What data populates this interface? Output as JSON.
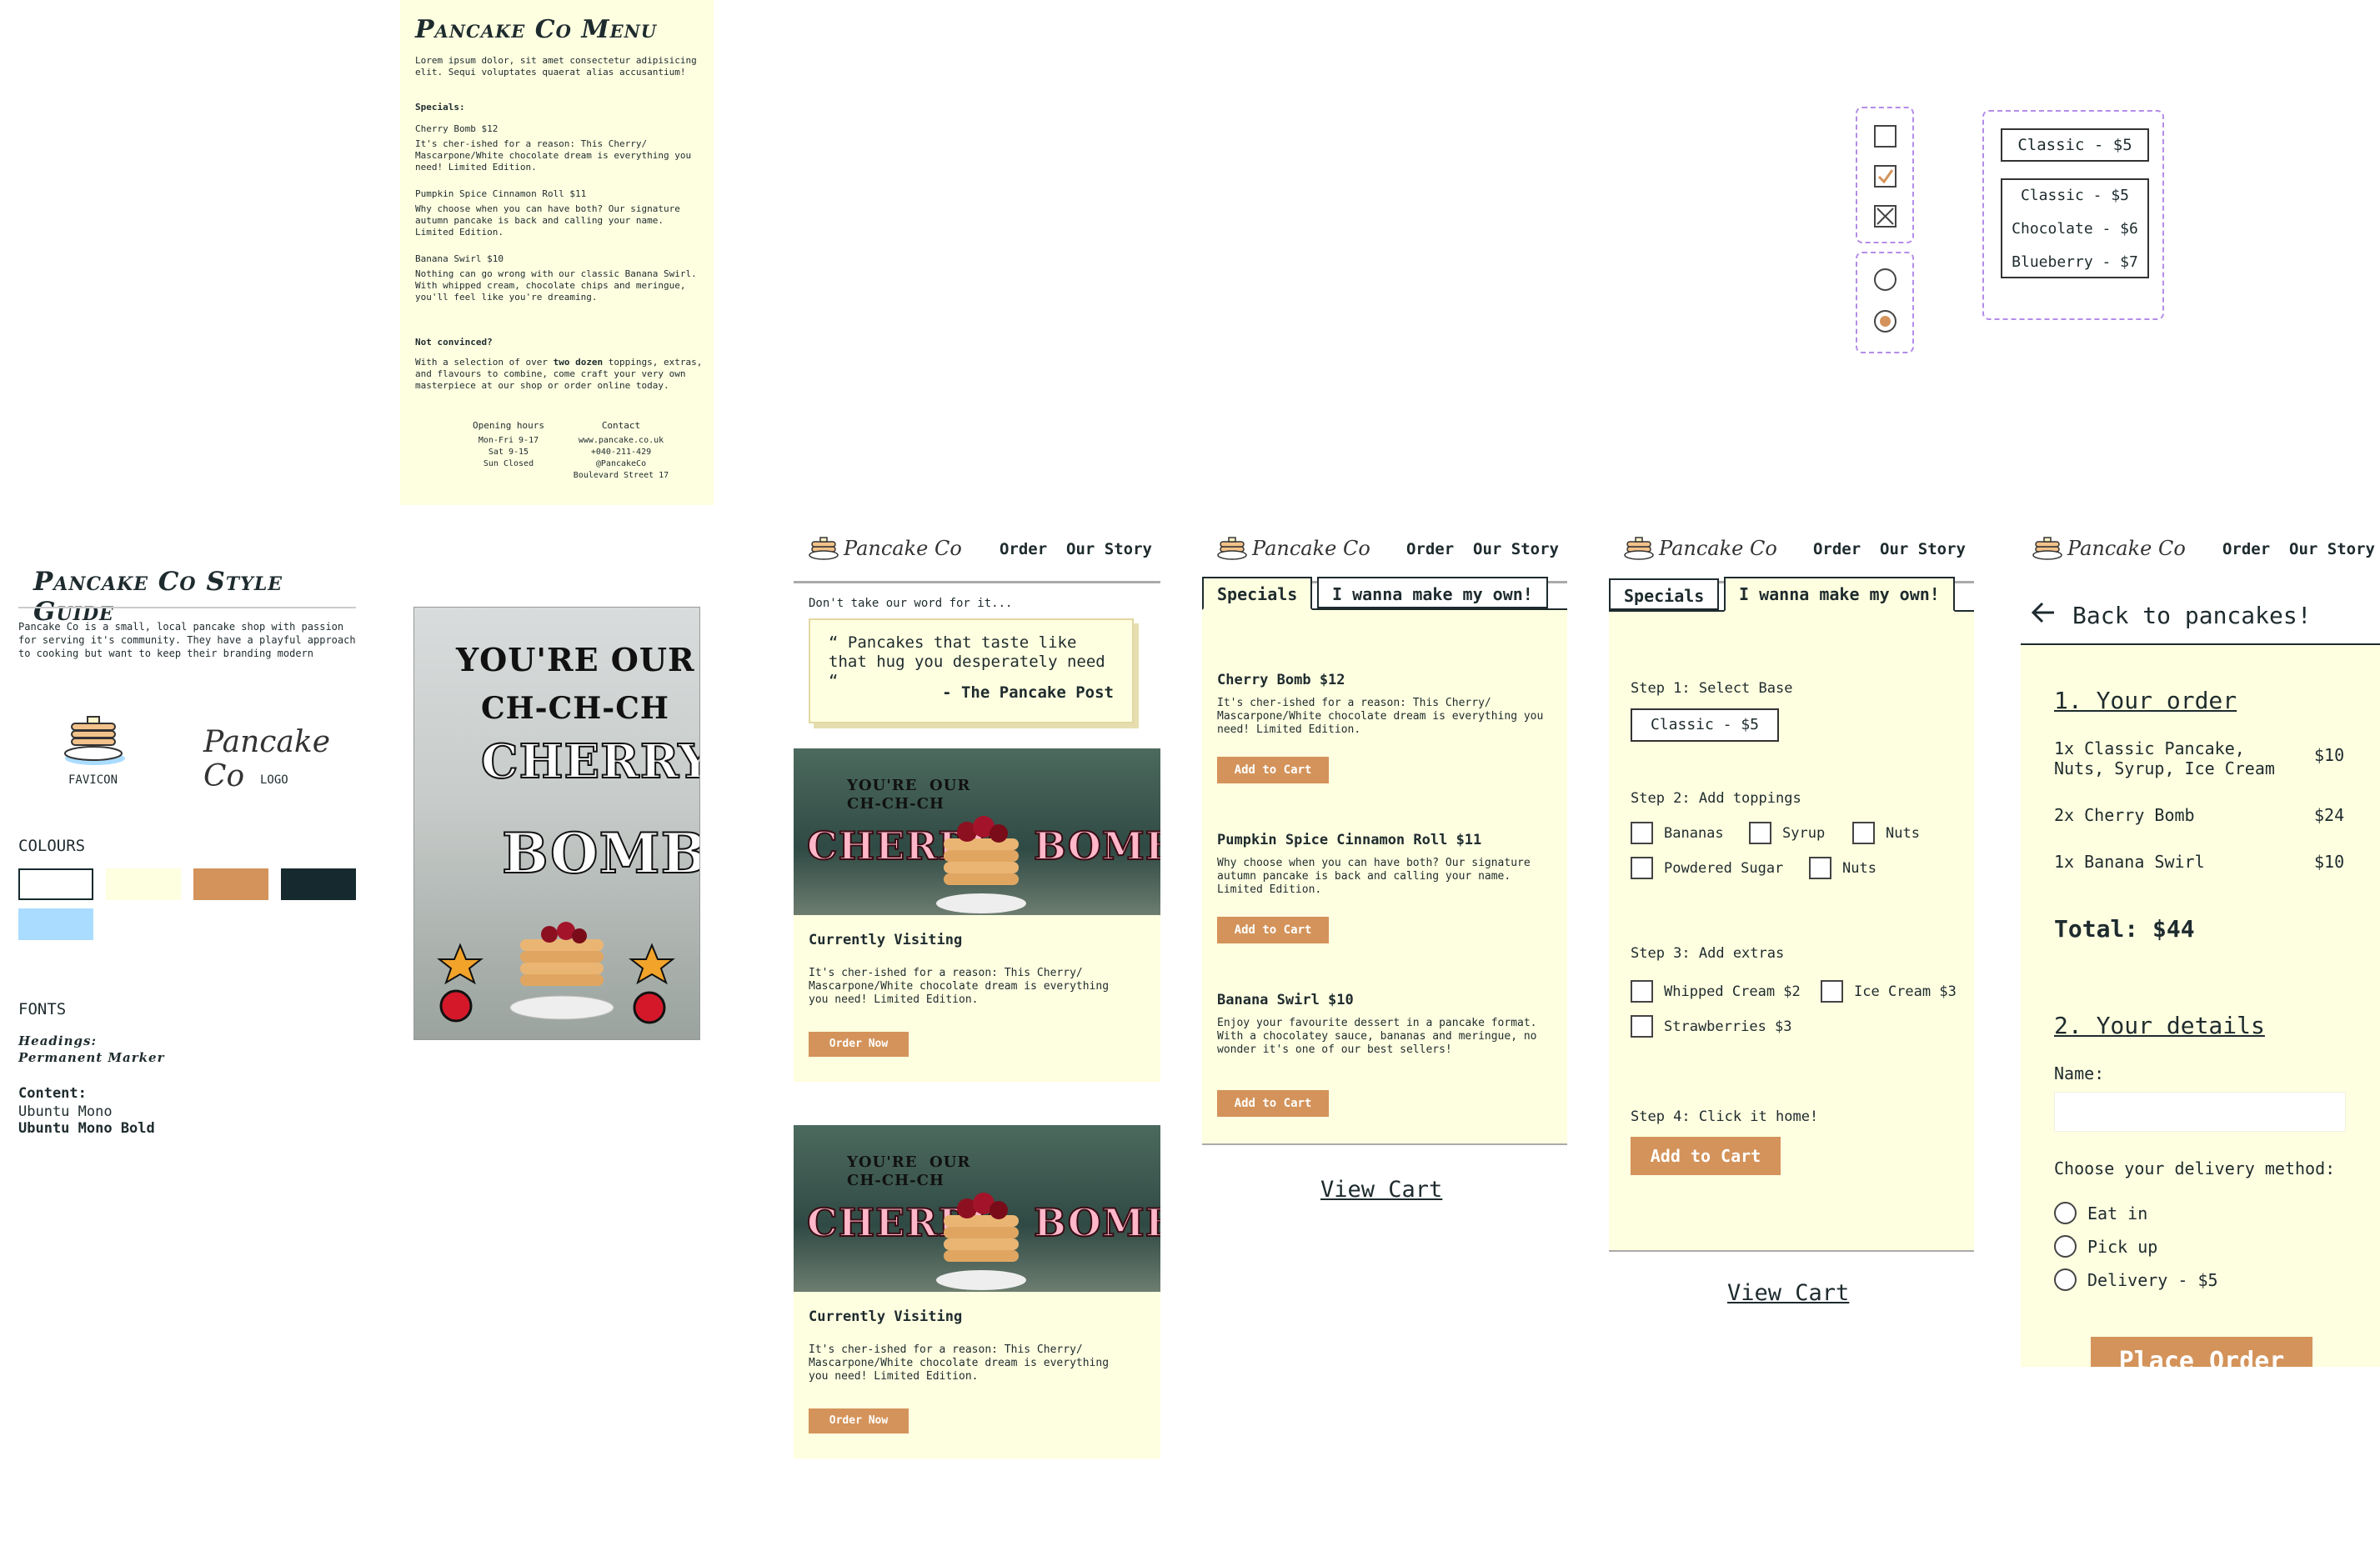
{
  "menu": {
    "title": "Pancake Co Menu",
    "intro": "Lorem ipsum dolor, sit amet consectetur adipisicing elit. Sequi voluptates quaerat alias accusantium!",
    "specials_heading": "Specials:",
    "items": [
      {
        "name": "Cherry Bomb $12",
        "desc": "It's cher-ished for a reason: This Cherry/ Mascarpone/White chocolate dream is everything you need! Limited Edition."
      },
      {
        "name": "Pumpkin Spice Cinnamon Roll $11",
        "desc": "Why choose when you can have both? Our signature autumn pancake is back and calling your name. Limited Edition."
      },
      {
        "name": "Banana Swirl $10",
        "desc": "Nothing can go wrong with our classic Banana Swirl. With whipped cream, chocolate chips and meringue, you'll feel like you're dreaming."
      }
    ],
    "not_convinced": "Not convinced?",
    "nc_text_1": "With a selection of over ",
    "nc_bold": "two dozen",
    "nc_text_2": " toppings, extras, and flavours to combine, come craft your very own masterpiece at our shop or order online today.",
    "hours_heading": "Opening hours",
    "hours": [
      "Mon-Fri 9-17",
      "Sat 9-15",
      "Sun Closed"
    ],
    "contact_heading": "Contact",
    "contact": [
      "www.pancake.co.uk",
      "+040-211-429",
      "@PancakeCo",
      "Boulevard Street 17"
    ]
  },
  "controls": {
    "select_value": "Classic - $5",
    "options": [
      "Classic - $5",
      "Chocolate - $6",
      "Blueberry - $7"
    ]
  },
  "styleguide": {
    "title": "Pancake Co Style Guide",
    "desc": "Pancake Co is a small, local pancake shop with passion for serving it's community. They have a playful approach to cooking but want to keep their branding modern",
    "favicon_label": "FAVICON",
    "logo_text": "Pancake Co",
    "logo_label": "LOGO",
    "colours_heading": "COLOURS",
    "colours": [
      "#ffffff",
      "#fefee0",
      "#d4935a",
      "#16292e",
      "#aadcff"
    ],
    "fonts_heading": "FONTS",
    "headings_label": "Headings:",
    "headings_font": "Permanent Marker",
    "content_label": "Content:",
    "content_font_1": "Ubuntu Mono",
    "content_font_2": "Ubuntu Mono Bold"
  },
  "poster": {
    "line1": "YOU'RE  OUR",
    "line2": "CH-CH-CH",
    "line3": "CHERRY",
    "line4": "BOMB"
  },
  "nav": {
    "logo": "Pancake Co",
    "link_order": "Order",
    "link_story": "Our Story"
  },
  "home": {
    "quote_intro": "Don't take our word for it...",
    "quote": "“ Pancakes that taste like that hug you desperately need “",
    "quote_source": "- The Pancake Post",
    "banner_small": "YOU'RE  OUR\nCH-CH-CH",
    "banner_cherry": "CHERRY",
    "banner_bomb": "BOMB!",
    "visiting": "Currently Visiting",
    "visiting_desc": "It's cher-ished for a reason: This Cherry/ Mascarpone/White chocolate dream is everything you need! Limited Edition.",
    "order_now": "Order Now"
  },
  "order": {
    "tab_specials": "Specials",
    "tab_custom": "I wanna make my own!",
    "specials": [
      {
        "name": "Cherry Bomb $12",
        "desc": "It's cher-ished for a reason: This Cherry/ Mascarpone/White chocolate dream is everything you need! Limited Edition."
      },
      {
        "name": "Pumpkin Spice Cinnamon Roll $11",
        "desc": "Why choose when you can have both? Our signature autumn pancake is back and calling your name. Limited Edition."
      },
      {
        "name": "Banana Swirl $10",
        "desc": "Enjoy your favourite dessert in a pancake format. With a chocolatey sauce, bananas and meringue, no wonder it's one of our best sellers!"
      }
    ],
    "add_to_cart": "Add to Cart",
    "view_cart": "View Cart"
  },
  "custom": {
    "step1": "Step 1: Select Base",
    "base_value": "Classic - $5",
    "step2": "Step 2: Add toppings",
    "toppings": [
      "Bananas",
      "Syrup",
      "Nuts",
      "Powdered Sugar",
      "Nuts"
    ],
    "step3": "Step 3: Add extras",
    "extras": [
      "Whipped Cream $2",
      "Ice Cream $3",
      "Strawberries $3"
    ],
    "step4": "Step 4: Click it home!",
    "add_to_cart": "Add to Cart",
    "view_cart": "View Cart"
  },
  "cart": {
    "back": "Back to pancakes!",
    "your_order": "1. Your order",
    "lines": [
      {
        "item": "1x Classic Pancake, Nuts, Syrup, Ice Cream",
        "price": "$10"
      },
      {
        "item": "2x Cherry Bomb",
        "price": "$24"
      },
      {
        "item": "1x Banana Swirl",
        "price": "$10"
      }
    ],
    "total": "Total: $44",
    "your_details": "2. Your details",
    "name_label": "Name:",
    "delivery_label": "Choose your delivery method:",
    "methods": [
      "Eat in",
      "Pick up",
      "Delivery - $5"
    ],
    "place_order": "Place Order"
  }
}
